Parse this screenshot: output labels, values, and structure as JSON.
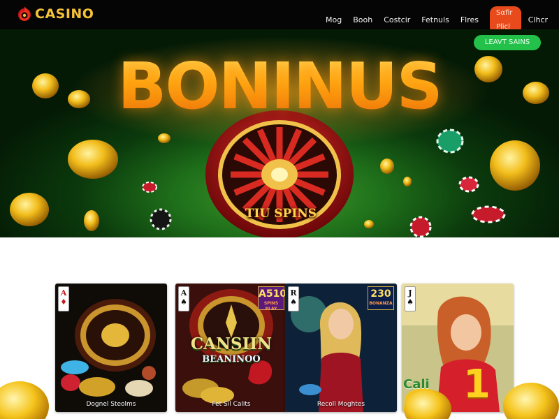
{
  "header": {
    "logo_text": "CASINO",
    "nav": [
      {
        "label": "Mog"
      },
      {
        "label": "Booh"
      },
      {
        "label": "Costcir"
      },
      {
        "label": "Fetnuls"
      },
      {
        "label": "Flres"
      }
    ],
    "cta_label": "Sαfir Plicl",
    "last_link": "Clhcr"
  },
  "hero": {
    "title": "BONINUS",
    "cta_label": "LEAVT SAINS",
    "wheel_label": "TIU SPINS"
  },
  "cards": [
    {
      "title": "Dognel Steolms",
      "playing_card": "A",
      "suit": "♦"
    },
    {
      "title": "Fet Sil Calits",
      "playing_card": "A",
      "suit": "♠",
      "badge_main": "A510",
      "badge_sub": "SPINS PLAY",
      "promo": "CANSIIN",
      "promo_sub": "BEANINOO"
    },
    {
      "title": "Recoll Moghtes",
      "playing_card": "R",
      "suit": "♠",
      "badge_main": "230",
      "badge_sub": "BONANZA"
    },
    {
      "title": "",
      "playing_card": "J",
      "suit": "♠",
      "side_word": "Cali",
      "big_num": "1"
    }
  ],
  "colors": {
    "accent_gold": "#f6c23a",
    "nav_cta": "#e84a1c",
    "hero_cta": "#23c04a",
    "header_bg": "#050505"
  },
  "icons": {
    "logo": "flame-chip-icon"
  }
}
